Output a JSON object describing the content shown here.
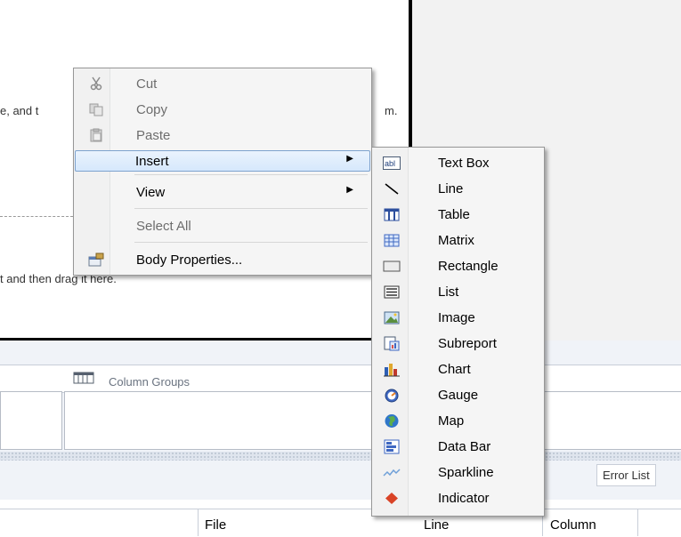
{
  "surface": {
    "hint_top": "e, and t",
    "hint_top_tail": "m.",
    "hint_bottom": "t and then drag it here."
  },
  "grouping": {
    "column_groups_label": "Column Groups"
  },
  "error_list": {
    "tab_label": "Error List",
    "columns": [
      "File",
      "Line",
      "Column"
    ]
  },
  "context_menu": {
    "items": [
      {
        "label": "Cut",
        "icon": "scissors-icon",
        "enabled": false
      },
      {
        "label": "Copy",
        "icon": "copy-icon",
        "enabled": false
      },
      {
        "label": "Paste",
        "icon": "paste-icon",
        "enabled": false
      },
      {
        "label": "Insert",
        "has_submenu": true,
        "highlighted": true
      },
      {
        "label": "View",
        "has_submenu": true
      },
      {
        "label": "Select All",
        "enabled": false
      },
      {
        "label": "Body Properties...",
        "icon": "properties-icon"
      }
    ]
  },
  "insert_submenu": {
    "items": [
      {
        "label": "Text Box",
        "icon": "textbox-icon"
      },
      {
        "label": "Line",
        "icon": "line-icon"
      },
      {
        "label": "Table",
        "icon": "table-icon"
      },
      {
        "label": "Matrix",
        "icon": "matrix-icon"
      },
      {
        "label": "Rectangle",
        "icon": "rectangle-icon"
      },
      {
        "label": "List",
        "icon": "list-icon"
      },
      {
        "label": "Image",
        "icon": "image-icon"
      },
      {
        "label": "Subreport",
        "icon": "subreport-icon"
      },
      {
        "label": "Chart",
        "icon": "chart-icon"
      },
      {
        "label": "Gauge",
        "icon": "gauge-icon"
      },
      {
        "label": "Map",
        "icon": "map-icon"
      },
      {
        "label": "Data Bar",
        "icon": "databar-icon"
      },
      {
        "label": "Sparkline",
        "icon": "sparkline-icon"
      },
      {
        "label": "Indicator",
        "icon": "indicator-icon"
      }
    ]
  },
  "colors": {
    "highlight_border": "#7da2ce",
    "menu_bg": "#f5f5f5",
    "indicator": "#d94326"
  }
}
